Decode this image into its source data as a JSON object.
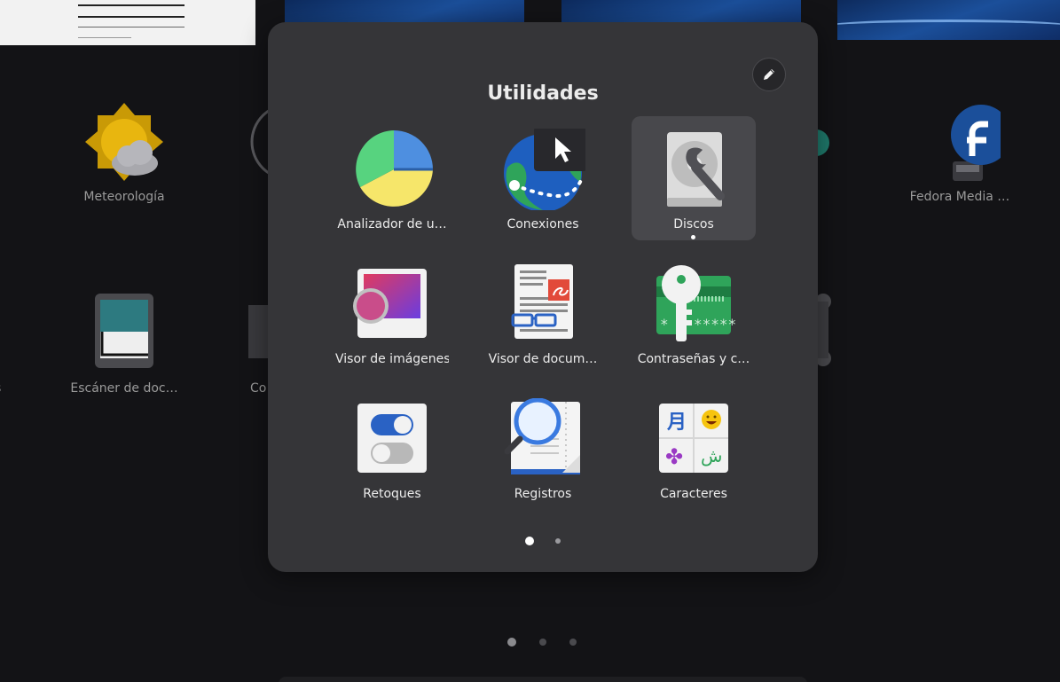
{
  "background": {
    "apps": [
      {
        "label": "Meteorología",
        "icon": "weather-icon"
      },
      {
        "label": "Fedora Media …",
        "icon": "fedora-media-writer-icon"
      },
      {
        "label": "Escáner de doc…",
        "icon": "document-scanner-icon"
      },
      {
        "label": "Co",
        "icon": "settings-icon"
      },
      {
        "label": "s",
        "icon": "partial-app-icon"
      }
    ],
    "pages": 3,
    "current_page": 1
  },
  "folder": {
    "title": "Utilidades",
    "edit_icon": "pencil-icon",
    "apps": [
      {
        "label": "Analizador de u…",
        "icon": "disk-usage-analyzer-icon"
      },
      {
        "label": "Conexiones",
        "icon": "connections-icon"
      },
      {
        "label": "Discos",
        "icon": "disks-icon",
        "selected": true,
        "running": true
      },
      {
        "label": "Visor de imágenes",
        "icon": "image-viewer-icon"
      },
      {
        "label": "Visor de docum…",
        "icon": "document-viewer-icon"
      },
      {
        "label": "Contraseñas y c…",
        "icon": "passwords-keys-icon"
      },
      {
        "label": "Retoques",
        "icon": "tweaks-icon"
      },
      {
        "label": "Registros",
        "icon": "logs-icon"
      },
      {
        "label": "Caracteres",
        "icon": "characters-icon"
      }
    ],
    "pages": 2,
    "current_page": 1
  },
  "colors": {
    "desktop_bg": "#131316",
    "folder_bg": "#353538",
    "selected_tile": "#48484c"
  }
}
